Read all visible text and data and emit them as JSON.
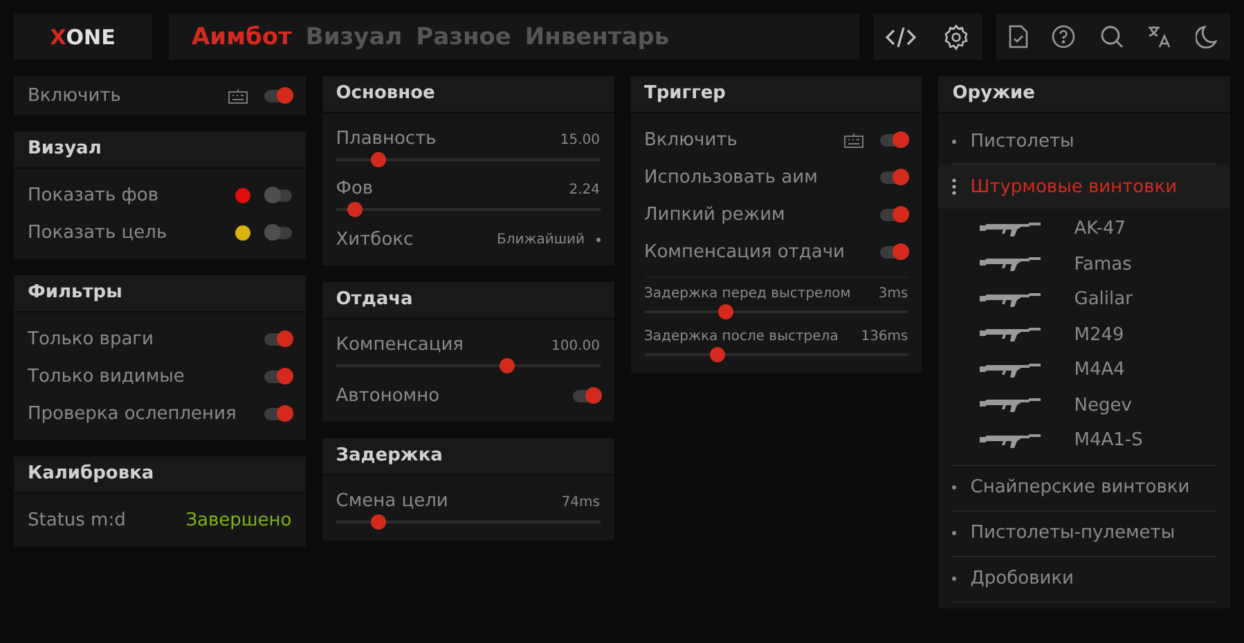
{
  "logo": {
    "accent": "X",
    "rest": "ONE"
  },
  "tabs": [
    {
      "label": "Аимбот",
      "selected": true
    },
    {
      "label": "Визуал",
      "selected": false
    },
    {
      "label": "Разное",
      "selected": false
    },
    {
      "label": "Инвентарь",
      "selected": false
    }
  ],
  "columns": [
    [
      {
        "rows": [
          {
            "kind": "toggle",
            "label": "Включить",
            "on": true,
            "keybind": true
          }
        ]
      },
      {
        "title": "Визуал",
        "rows": [
          {
            "kind": "toggle",
            "label": "Показать фов",
            "on": false,
            "color": "#e00d0d"
          },
          {
            "kind": "toggle",
            "label": "Показать цель",
            "on": false,
            "color": "#d8b30c"
          }
        ]
      },
      {
        "title": "Фильтры",
        "rows": [
          {
            "kind": "toggle",
            "label": "Только враги",
            "on": true
          },
          {
            "kind": "toggle",
            "label": "Только видимые",
            "on": true
          },
          {
            "kind": "toggle",
            "label": "Проверка ослепления",
            "on": true
          }
        ]
      },
      {
        "title": "Калибровка",
        "rows": [
          {
            "kind": "status",
            "label": "Status m:d",
            "value": "Завершено"
          }
        ]
      }
    ],
    [
      {
        "title": "Основное",
        "rows": [
          {
            "kind": "slider",
            "label": "Плавность",
            "value": "15.00",
            "level": 0.16
          },
          {
            "kind": "slider",
            "label": "Фов",
            "value": "2.24",
            "level": 0.07
          },
          {
            "kind": "select",
            "label": "Хитбокс",
            "value": "Ближайший"
          }
        ]
      },
      {
        "title": "Отдача",
        "rows": [
          {
            "kind": "slider",
            "label": "Компенсация",
            "value": "100.00",
            "level": 0.65
          },
          {
            "kind": "toggle",
            "label": "Автономно",
            "on": true
          }
        ]
      },
      {
        "title": "Задержка",
        "rows": [
          {
            "kind": "slider",
            "label": "Смена цели",
            "value": "74ms",
            "level": 0.16
          }
        ]
      }
    ],
    [
      {
        "title": "Триггер",
        "rows": [
          {
            "kind": "toggle",
            "label": "Включить",
            "on": true,
            "keybind": true
          },
          {
            "kind": "toggle",
            "label": "Использовать аим",
            "on": true
          },
          {
            "kind": "toggle",
            "label": "Липкий режим",
            "on": true
          },
          {
            "kind": "toggle",
            "label": "Компенсация отдачи",
            "on": true
          },
          {
            "kind": "small-slider",
            "label": "Задержка перед выстрелом",
            "value": "3ms",
            "level": 0.31
          },
          {
            "kind": "small-slider",
            "label": "Задержка после выстрела",
            "value": "136ms",
            "level": 0.28
          }
        ]
      }
    ]
  ],
  "weapons": {
    "title": "Оружие",
    "categories": [
      {
        "label": "Пистолеты",
        "selected": false,
        "expanded": false
      },
      {
        "label": "Штурмовые винтовки",
        "selected": true,
        "expanded": true,
        "children": [
          {
            "name": "AK-47"
          },
          {
            "name": "Famas"
          },
          {
            "name": "Galilar"
          },
          {
            "name": "M249"
          },
          {
            "name": "M4A4"
          },
          {
            "name": "Negev"
          },
          {
            "name": "M4A1-S"
          }
        ]
      },
      {
        "label": "Снайперские винтовки",
        "selected": false,
        "expanded": false
      },
      {
        "label": "Пистолеты-пулеметы",
        "selected": false,
        "expanded": false
      },
      {
        "label": "Дробовики",
        "selected": false,
        "expanded": false
      }
    ]
  }
}
